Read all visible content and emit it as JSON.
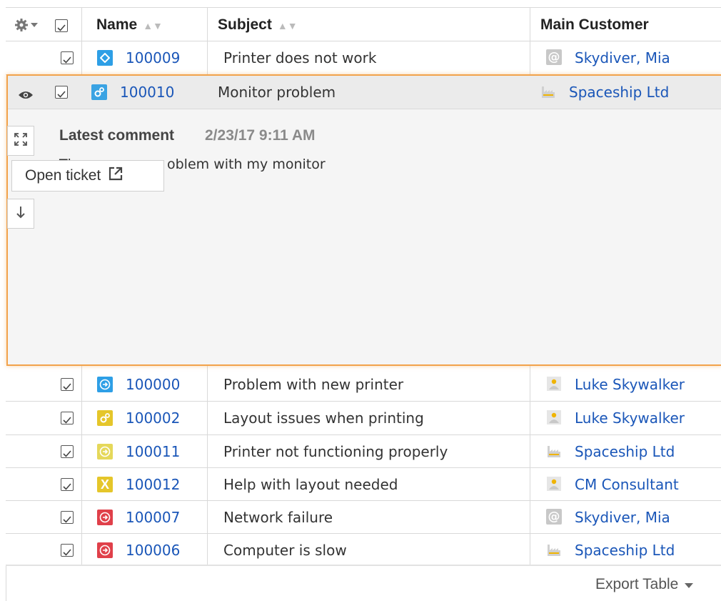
{
  "table": {
    "columns": [
      {
        "label": "Name",
        "sort_icon": "sort-icon"
      },
      {
        "label": "Subject",
        "sort_icon": "sort-icon"
      },
      {
        "label": "Main Customer"
      }
    ],
    "settings_icon": "gear-icon",
    "header_checkbox_checked": true
  },
  "rows_top": [
    {
      "id": "100009",
      "subject": "Printer does not work",
      "customer": "Skydiver, Mia",
      "type_icon": "diamond-icon",
      "type_color": "#2e9fe6",
      "customer_icon": "at-icon",
      "checked": true
    }
  ],
  "selected_row": {
    "id": "100010",
    "subject": "Monitor problem",
    "customer": "Spaceship Ltd",
    "type_icon": "cogs-icon",
    "type_color": "#3aa3e3",
    "customer_icon": "factory-icon",
    "checked": true,
    "preview_icon": "eye-icon"
  },
  "preview": {
    "comment_title": "Latest comment",
    "comment_date": "2/23/17 9:11 AM",
    "comment_text_visible_head": "Th",
    "comment_text_visible_tail": "oblem with my monitor",
    "open_ticket_label": "Open ticket",
    "expand_icon": "expand-icon",
    "external_link_icon": "external-link-icon",
    "down_arrow_icon": "arrow-down-icon",
    "accent_color": "#f2a24a"
  },
  "rows_bottom": [
    {
      "id": "100000",
      "subject": "Problem with new printer",
      "customer": "Luke Skywalker",
      "type_icon": "arrow-circle-icon",
      "type_color": "#2e9fe6",
      "customer_icon": "person-icon",
      "checked": true
    },
    {
      "id": "100002",
      "subject": "Layout issues when printing",
      "customer": "Luke Skywalker",
      "type_icon": "cogs-icon",
      "type_color": "#e5c62a",
      "customer_icon": "person-icon",
      "checked": true
    },
    {
      "id": "100011",
      "subject": "Printer not functioning properly",
      "customer": "Spaceship Ltd",
      "type_icon": "arrow-circle-icon",
      "type_color": "#e5d85a",
      "customer_icon": "factory-icon",
      "checked": true
    },
    {
      "id": "100012",
      "subject": "Help with layout needed",
      "customer": "CM Consultant",
      "type_icon": "x-icon",
      "type_color": "#e5c62a",
      "customer_icon": "person-icon",
      "checked": true
    },
    {
      "id": "100007",
      "subject": "Network failure",
      "customer": "Skydiver, Mia",
      "type_icon": "arrow-circle-icon",
      "type_color": "#e0404a",
      "customer_icon": "at-icon",
      "checked": true
    },
    {
      "id": "100006",
      "subject": "Computer is slow",
      "customer": "Spaceship Ltd",
      "type_icon": "arrow-circle-icon",
      "type_color": "#e0404a",
      "customer_icon": "factory-icon",
      "checked": true
    }
  ],
  "footer": {
    "export_label": "Export Table",
    "export_icon": "caret-down-icon"
  },
  "colors": {
    "link": "#1a56b8",
    "grid_line": "#d9d9d9",
    "preview_bg": "#f5f5f5"
  }
}
